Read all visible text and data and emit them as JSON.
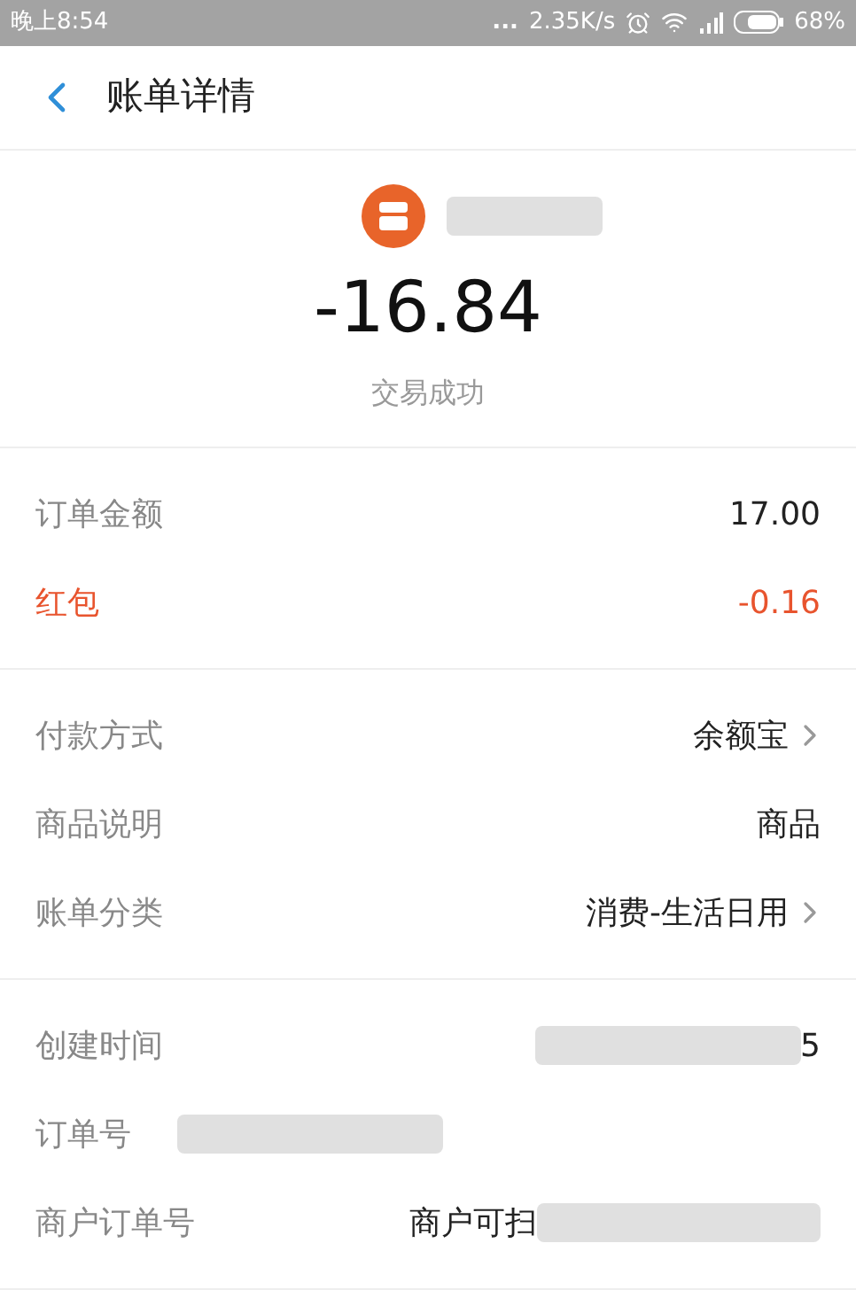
{
  "status_bar": {
    "time": "晚上8:54",
    "dots": "...",
    "speed": "2.35K/s",
    "battery": "68%"
  },
  "header": {
    "title": "账单详情"
  },
  "summary": {
    "amount": "-16.84",
    "status": "交易成功"
  },
  "sections": [
    {
      "rows": [
        {
          "label": "订单金额",
          "value": "17.00",
          "kind": "plain"
        },
        {
          "label": "红包",
          "value": "-0.16",
          "kind": "discount"
        }
      ]
    },
    {
      "rows": [
        {
          "label": "付款方式",
          "value": "余额宝",
          "kind": "plain",
          "link": true
        },
        {
          "label": "商品说明",
          "value": "商品",
          "kind": "plain"
        },
        {
          "label": "账单分类",
          "value": "消费-生活日用",
          "kind": "plain",
          "link": true
        }
      ]
    },
    {
      "rows": [
        {
          "label": "创建时间",
          "value": "5",
          "kind": "redacted"
        },
        {
          "label": "订单号",
          "kind": "hidden"
        },
        {
          "label": "商户订单号",
          "value": "商户可扫",
          "kind": "redacted"
        }
      ]
    }
  ]
}
